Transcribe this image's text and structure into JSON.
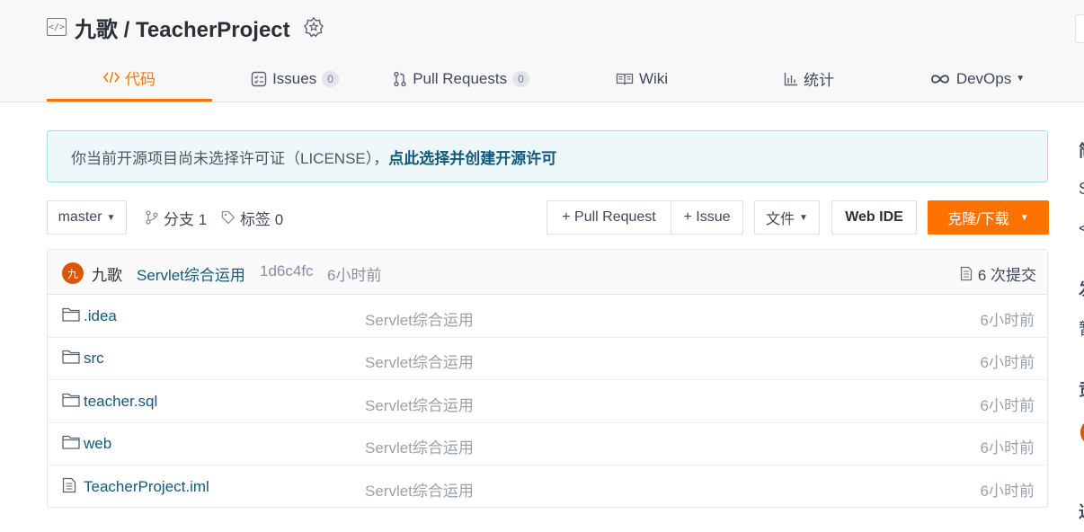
{
  "repo": {
    "owner": "九歌",
    "separator": " / ",
    "name": "TeacherProject"
  },
  "tabs": [
    {
      "label": "代码",
      "icon": "code-icon",
      "active": true
    },
    {
      "label": "Issues",
      "icon": "issues-icon",
      "count": "0"
    },
    {
      "label": "Pull Requests",
      "icon": "pull-request-icon",
      "count": "0"
    },
    {
      "label": "Wiki",
      "icon": "book-icon"
    },
    {
      "label": "统计",
      "icon": "bar-chart-icon"
    },
    {
      "label": "DevOps",
      "icon": "infinity-icon",
      "dropdown": true
    }
  ],
  "notice": {
    "text": "你当前开源项目尚未选择许可证（LICENSE），",
    "link": "点此选择并创建开源许可"
  },
  "toolbar": {
    "branch": "master",
    "branches": "分支 1",
    "tags": "标签 0",
    "pull_request": "+ Pull Request",
    "issue": "+ Issue",
    "file": "文件",
    "web_ide": "Web IDE",
    "clone": "克隆/下载"
  },
  "commit": {
    "avatar_char": "九",
    "author": "九歌",
    "message": "Servlet综合运用",
    "sha": "1d6c4fc",
    "time": "6小时前",
    "count": "6 次提交"
  },
  "files": [
    {
      "type": "folder",
      "name": ".idea",
      "message": "Servlet综合运用",
      "time": "6小时前"
    },
    {
      "type": "folder",
      "name": "src",
      "message": "Servlet综合运用",
      "time": "6小时前"
    },
    {
      "type": "folder",
      "name": "teacher.sql",
      "message": "Servlet综合运用",
      "time": "6小时前"
    },
    {
      "type": "folder",
      "name": "web",
      "message": "Servlet综合运用",
      "time": "6小时前"
    },
    {
      "type": "file",
      "name": "TeacherProject.iml",
      "message": "Servlet综合运用",
      "time": "6小时前"
    }
  ],
  "colors": {
    "accent": "#fe7300",
    "link": "#125a7a",
    "notice_bg": "#eef8fb"
  },
  "sidebar_partial": [
    "简",
    "S",
    "<",
    "发",
    "暂",
    "贡",
    "近"
  ]
}
